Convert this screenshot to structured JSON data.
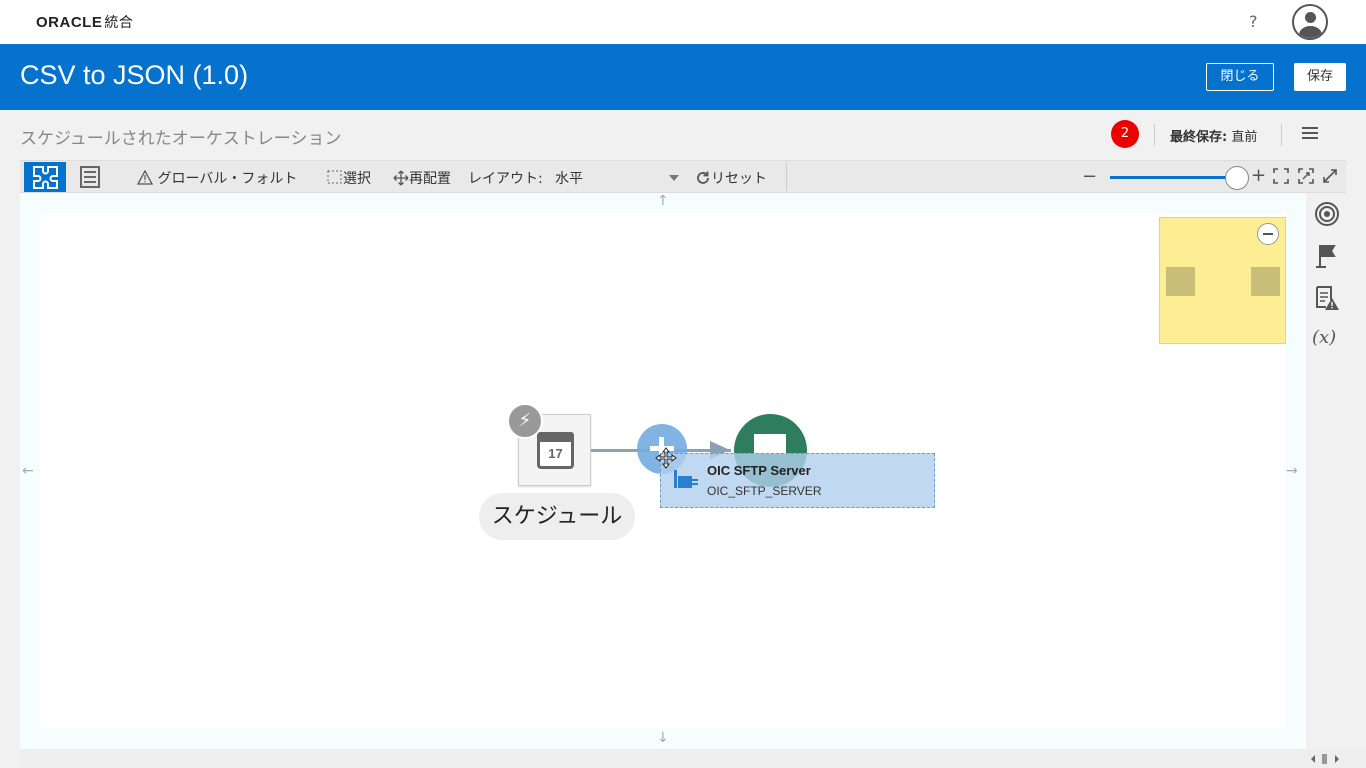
{
  "header": {
    "brand": "ORACLE",
    "brand_sub": "統合",
    "help_label": "?"
  },
  "titlebar": {
    "title": "CSV to JSON (1.0)",
    "close_label": "閉じる",
    "save_label": "保存"
  },
  "subheader": {
    "subtitle": "スケジュールされたオーケストレーション",
    "error_count": "2",
    "last_saved_label": "最終保存:",
    "last_saved_value": "直前"
  },
  "toolbar": {
    "global_fault": "グローバル・フォルト",
    "select": "選択",
    "rearrange": "再配置",
    "layout_label": "レイアウト:",
    "layout_value": "水平",
    "reset": "リセット"
  },
  "canvas": {
    "schedule_date": "17",
    "schedule_label": "スケジュール",
    "drag_title": "OIC SFTP Server",
    "drag_subtitle": "OIC_SFTP_SERVER",
    "right_rail_variable": "(x)"
  },
  "colors": {
    "brand_blue": "#0572ce",
    "error_red": "#ee0000",
    "node_green": "#2e7d60",
    "overview_yellow": "#fdee94"
  }
}
